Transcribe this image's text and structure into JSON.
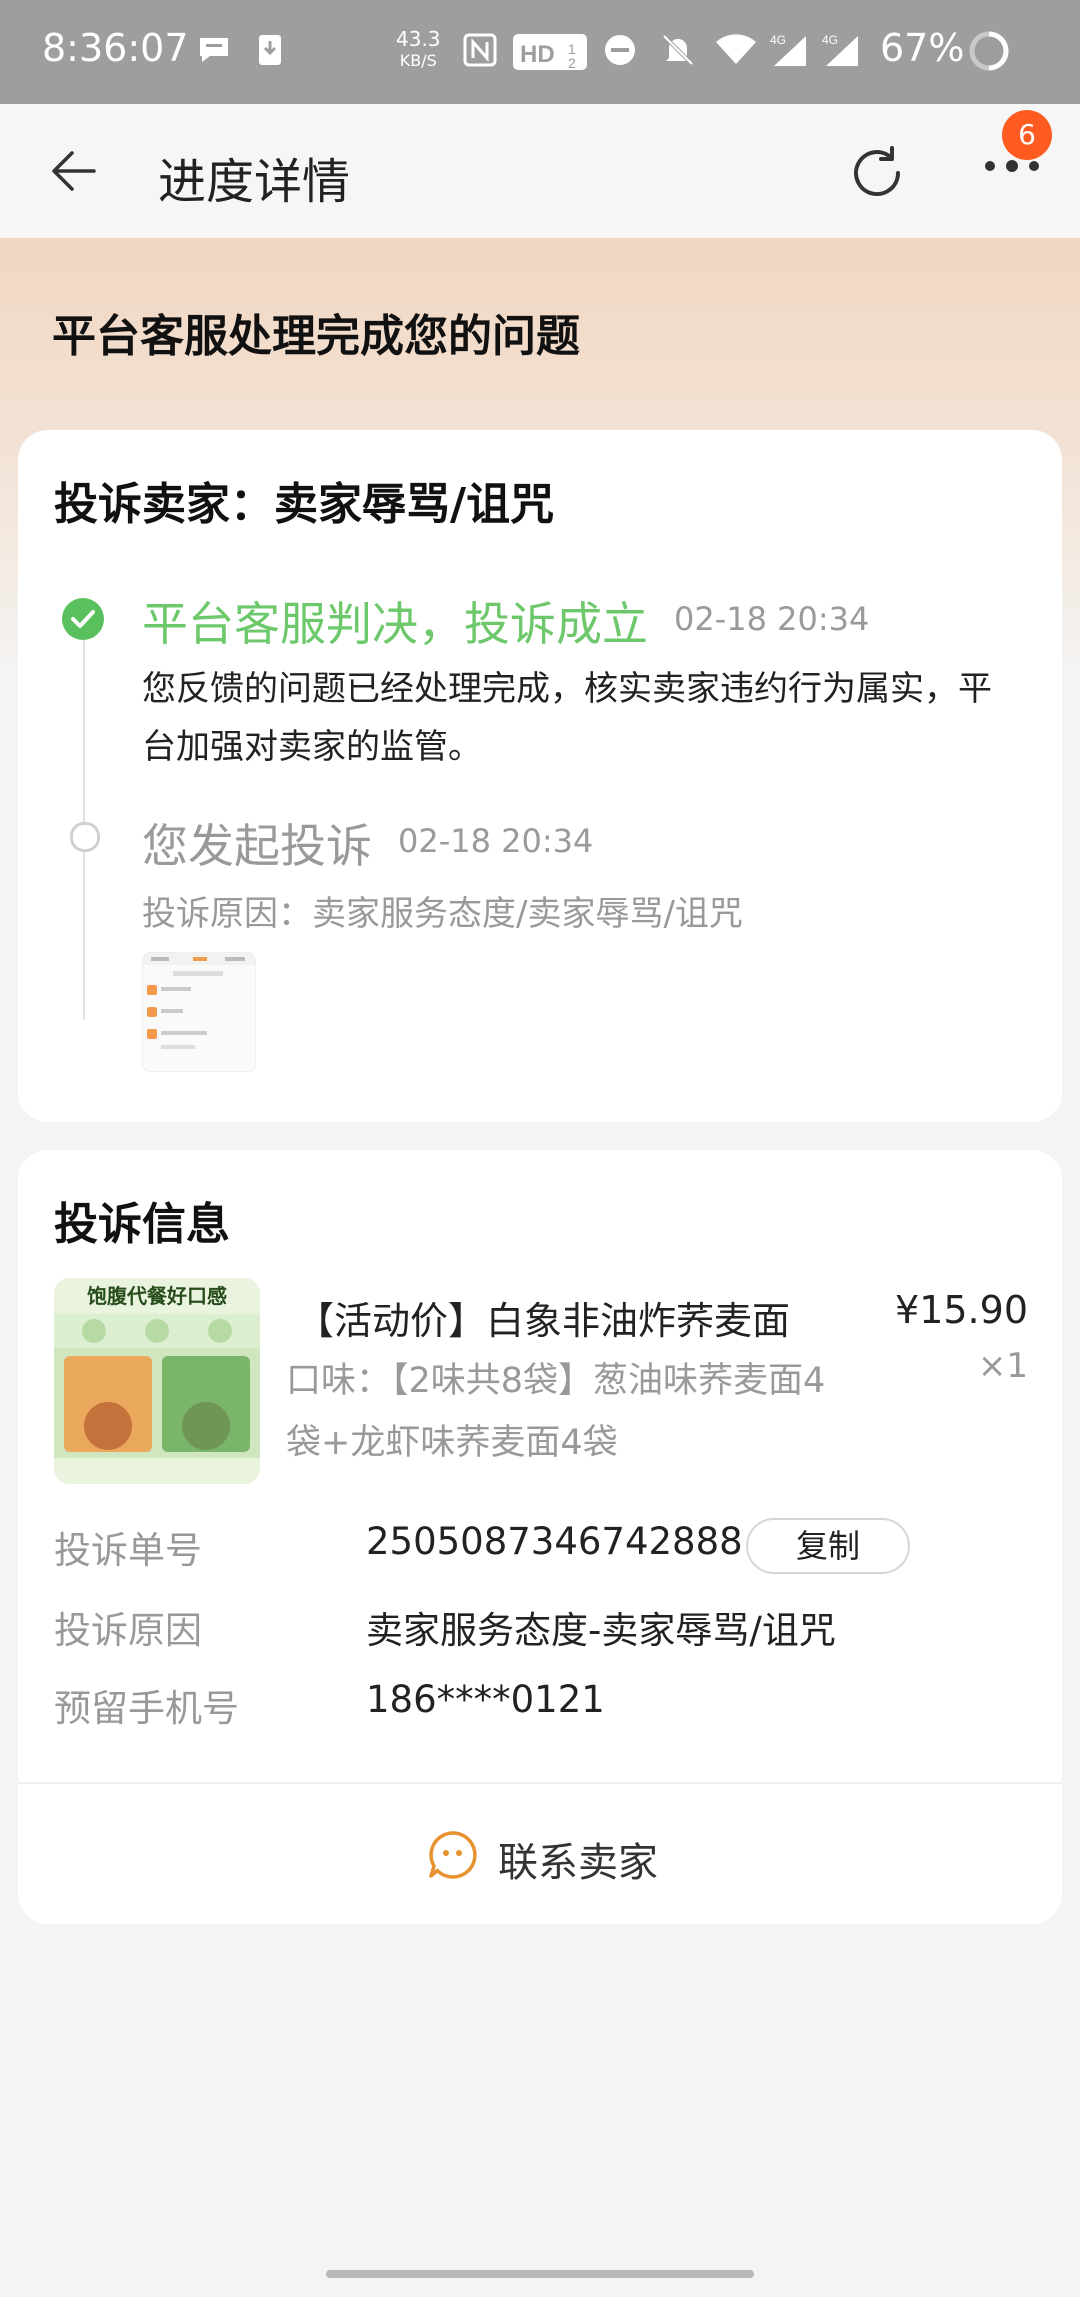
{
  "status_bar": {
    "time": "8:36:07",
    "net_speed_value": "43.3",
    "net_speed_unit": "KB/S",
    "battery": "67%"
  },
  "header": {
    "title": "进度详情",
    "badge_count": "6"
  },
  "banner": {
    "title": "平台客服处理完成您的问题"
  },
  "complaint": {
    "title": "投诉卖家：卖家辱骂/诅咒",
    "steps": [
      {
        "title": "平台客服判决，投诉成立",
        "time": "02-18 20:34",
        "desc": "您反馈的问题已经处理完成，核实卖家违约行为属实，平台加强对卖家的监管。"
      },
      {
        "title": "您发起投诉",
        "time": "02-18 20:34",
        "reason": "投诉原因：卖家服务态度/卖家辱骂/诅咒"
      }
    ]
  },
  "info": {
    "title": "投诉信息",
    "product": {
      "image_caption": "饱腹代餐好口感",
      "name": "【活动价】白象非油炸荞麦面",
      "price": "¥15.90",
      "qty": "×1",
      "spec": "口味：【2味共8袋】葱油味荞麦面4袋+龙虾味荞麦面4袋"
    },
    "rows": [
      {
        "label": "投诉单号",
        "value": "2505087346742888"
      },
      {
        "label": "投诉原因",
        "value": "卖家服务态度-卖家辱骂/诅咒"
      },
      {
        "label": "预留手机号",
        "value": "186****0121"
      }
    ],
    "copy_label": "复制",
    "contact_label": "联系卖家"
  },
  "colors": {
    "success_green": "#5ac05e",
    "badge_orange": "#ff5a1f",
    "contact_orange": "#e8912f"
  }
}
